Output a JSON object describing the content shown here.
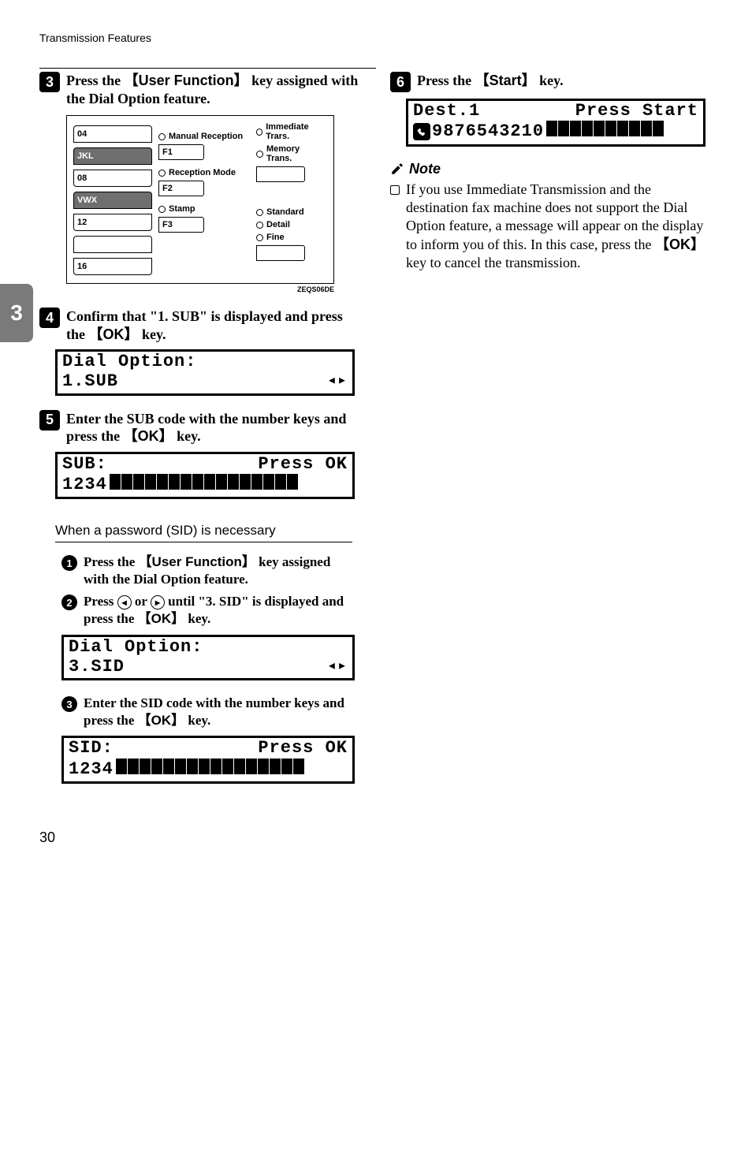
{
  "header": {
    "section": "Transmission Features"
  },
  "sideTab": "3",
  "left": {
    "step3": {
      "num": "3",
      "textA": "Press the ",
      "key": "【User Function】",
      "textB": " key assigned with the Dial Option feature."
    },
    "panel": {
      "rows1": [
        "04",
        "JKL",
        "08",
        "VWX",
        "12",
        "",
        "16"
      ],
      "mid": {
        "manual": "Manual Reception",
        "f1": "F1",
        "recep": "Reception Mode",
        "f2": "F2",
        "stamp": "Stamp",
        "f3": "F3"
      },
      "right": {
        "immed": "Immediate Trars.",
        "mem": "Memory Trans.",
        "std": "Standard",
        "det": "Detail",
        "fine": "Fine"
      },
      "caption": "ZEQS06DE"
    },
    "step4": {
      "num": "4",
      "textA": "Confirm that \"1. SUB\" is displayed and press the ",
      "key": "【OK】",
      "textB": " key."
    },
    "lcd4": {
      "line1": "Dial Option:",
      "line2": "1.SUB",
      "arrows": "◂▸"
    },
    "step5": {
      "num": "5",
      "textA": "Enter the SUB code with the number keys and press the ",
      "key": "【OK】",
      "textB": " key."
    },
    "lcd5": {
      "l1a": "SUB:",
      "l1b": "Press OK",
      "line2": "1234",
      "blocks": 16
    },
    "subhead": "When a password (SID) is necessary",
    "sub1": {
      "n": "1",
      "a": "Press the ",
      "k": "【User Function】",
      "b": " key assigned with the Dial Option feature."
    },
    "sub2": {
      "n": "2",
      "a": "Press ",
      "mid": " or ",
      "b": " until \"3. SID\" is displayed and press the ",
      "k": "【OK】",
      "c": " key."
    },
    "lcdS2": {
      "line1": "Dial Option:",
      "line2": "3.SID",
      "arrows": "◂▸"
    },
    "sub3": {
      "n": "3",
      "a": "Enter the SID code with the number keys and press the ",
      "k": "【OK】",
      "b": " key."
    },
    "lcdS3": {
      "l1a": "SID:",
      "l1b": "Press OK",
      "line2": "1234",
      "blocks": 16
    }
  },
  "right": {
    "step6": {
      "num": "6",
      "a": "Press the ",
      "k": "【Start】",
      "b": " key."
    },
    "lcd6": {
      "l1a": "Dest.1",
      "l1b": "Press Start",
      "line2": "9876543210",
      "blocks": 10
    },
    "noteHead": "Note",
    "noteText": "If you use Immediate Transmission and the destination fax machine does not support the Dial Option feature, a message will appear on the display to inform you of this. In this case, press the ",
    "noteKey": "【OK】",
    "noteTail": " key to cancel the transmission."
  },
  "pageNumber": "30"
}
